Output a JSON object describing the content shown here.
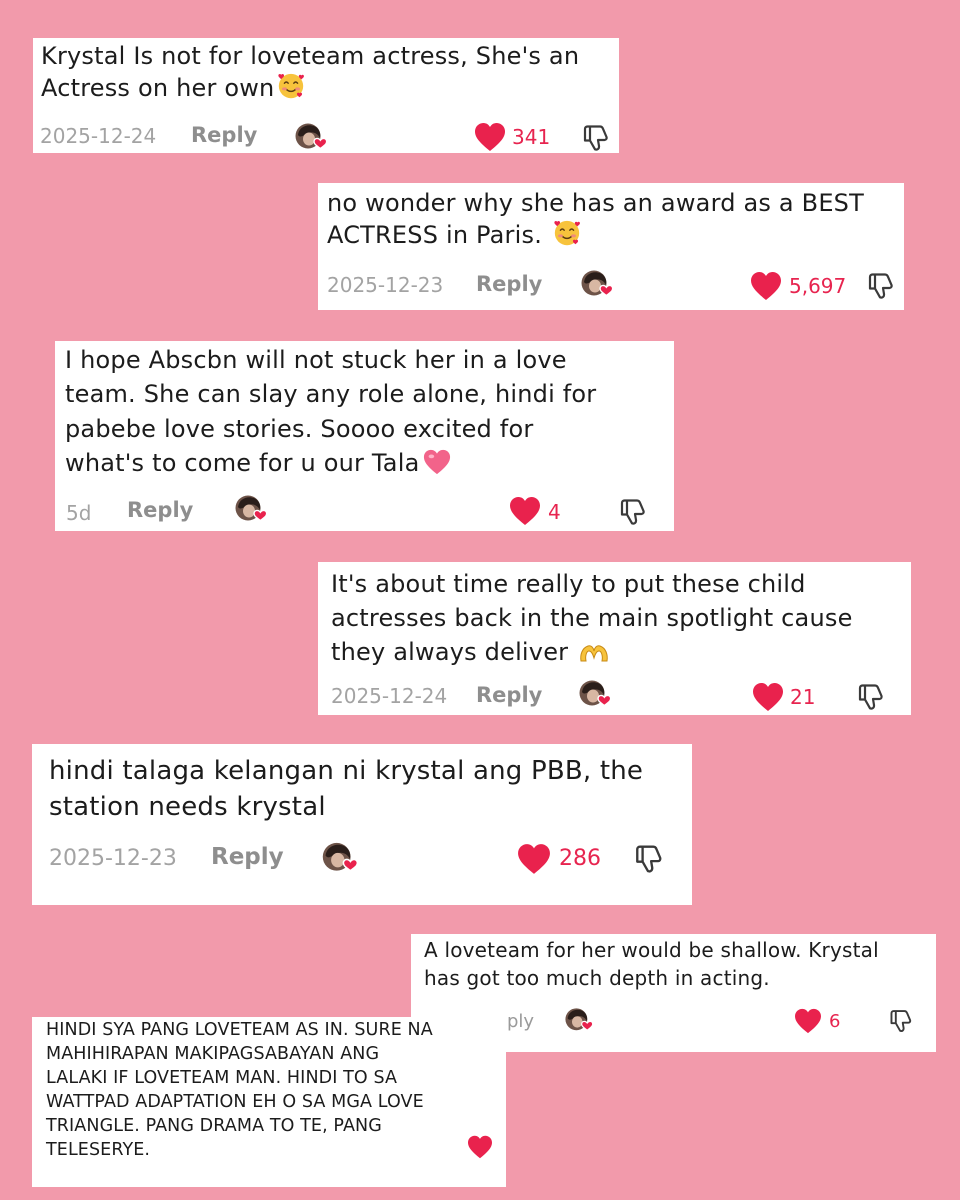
{
  "colors": {
    "background": "#f29aab",
    "heart": "#e9224d",
    "count": "#e7244f",
    "meta": "#a3a3a3"
  },
  "icons": {
    "avatar": "avatar-with-heart-icon",
    "like": "heart-icon",
    "dislike": "thumbs-down-icon",
    "smiling_hearts": "smiling-face-with-hearts-emoji",
    "heart_emoji": "pink-heart-emoji",
    "heart_hands": "heart-hands-emoji"
  },
  "comments": [
    {
      "lines": [
        "Krystal Is not for loveteam actress, She's an",
        "Actress on her own"
      ],
      "date": "2025-12-24",
      "reply": "Reply",
      "likes": "341"
    },
    {
      "lines": [
        "no wonder why she has an award as a BEST",
        "ACTRESS in Paris. "
      ],
      "date": "2025-12-23",
      "reply": "Reply",
      "likes": "5,697"
    },
    {
      "lines": [
        "I hope Abscbn will not stuck her in a love",
        "team. She can slay any role alone, hindi for",
        "pabebe love stories. Soooo excited for",
        "what's to come for u our Tala"
      ],
      "date": "5d",
      "reply": "Reply",
      "likes": "4"
    },
    {
      "lines": [
        "It's about time really to put these child",
        "actresses back in the main spotlight cause",
        "they always deliver "
      ],
      "date": "2025-12-24",
      "reply": "Reply",
      "likes": "21"
    },
    {
      "lines": [
        "hindi talaga kelangan ni krystal ang PBB, the",
        "station needs krystal"
      ],
      "date": "2025-12-23",
      "reply": "Reply",
      "likes": "286"
    },
    {
      "lines": [
        "A loveteam for her would be shallow. Krystal",
        "has got too much depth in acting."
      ],
      "reply": "ply",
      "likes": "6"
    },
    {
      "lines": [
        "HINDI SYA PANG LOVETEAM AS IN. SURE NA",
        "MAHIHIRAPAN MAKIPAGSABAYAN ANG",
        "LALAKI IF LOVETEAM MAN. HINDI TO SA",
        "WATTPAD ADAPTATION EH O SA MGA LOVE",
        "TRIANGLE. PANG DRAMA TO TE, PANG",
        "TELESERYE."
      ]
    }
  ]
}
